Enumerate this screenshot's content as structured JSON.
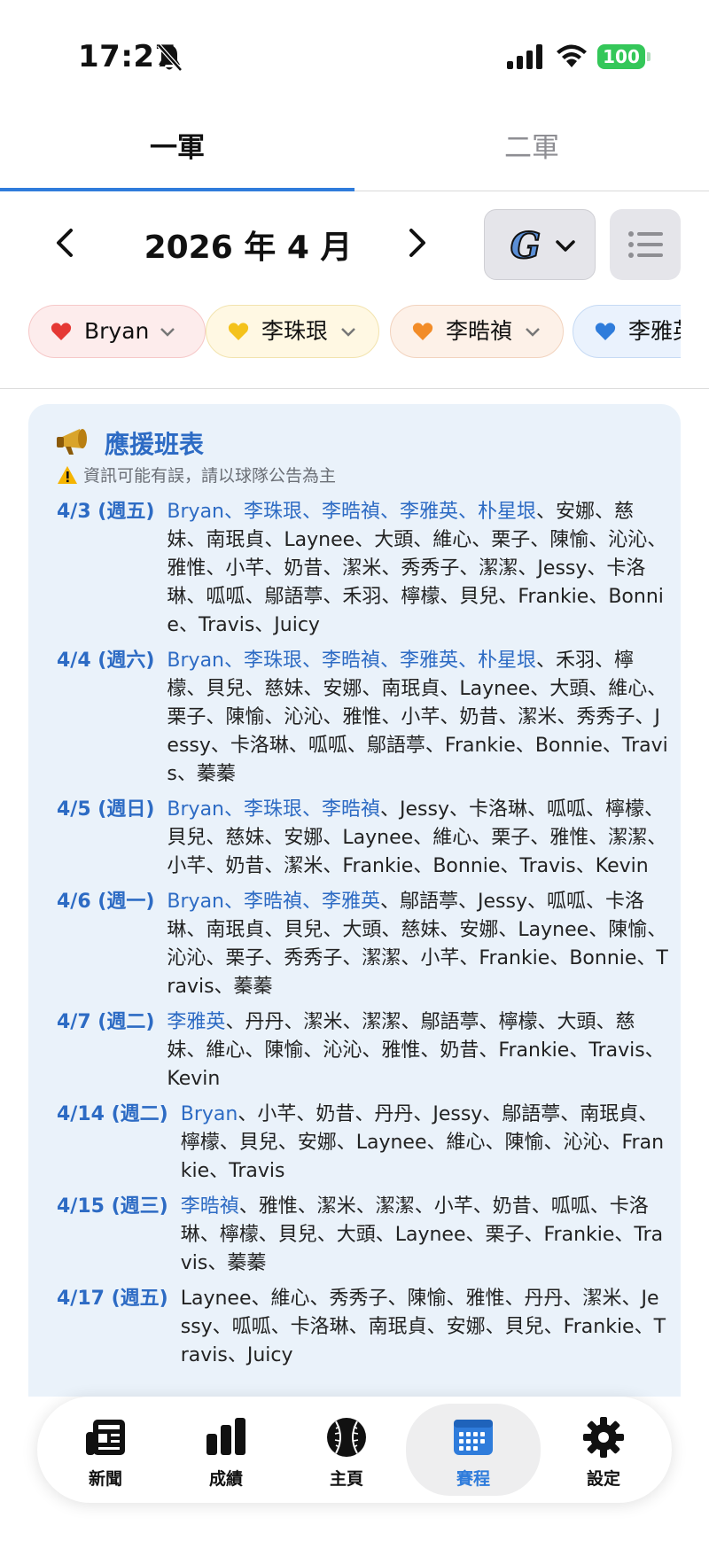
{
  "status": {
    "time": "17:27",
    "battery": "100"
  },
  "team_tabs": [
    {
      "label": "一軍",
      "active": true
    },
    {
      "label": "二軍",
      "active": false
    }
  ],
  "month_nav": {
    "label": "2026 年 4 月"
  },
  "team_selector": {
    "logo": "G"
  },
  "chips": [
    {
      "label": "Bryan",
      "color": "#e53935"
    },
    {
      "label": "李珠珢",
      "color": "#f4c21b"
    },
    {
      "label": "李晧禎",
      "color": "#f28c28"
    },
    {
      "label": "李雅英",
      "color": "#2f7cdb"
    }
  ],
  "roster": {
    "title": "應援班表",
    "note": "資訊可能有誤，請以球隊公告為主",
    "rows": [
      {
        "date": "4/3 (週五)",
        "highlight": "Bryan、李珠珢、李晧禎、李雅英、朴星垠",
        "names": "、安娜、慈妹、南珉貞、Laynee、大頭、維心、栗子、陳愉、沁沁、雅惟、小芊、奶昔、潔米、秀秀子、潔潔、Jessy、卡洛琳、呱呱、鄔語葶、禾羽、檸檬、貝兒、Frankie、Bonnie、Travis、Juicy"
      },
      {
        "date": "4/4 (週六)",
        "highlight": "Bryan、李珠珢、李晧禎、李雅英、朴星垠",
        "names": "、禾羽、檸檬、貝兒、慈妹、安娜、南珉貞、Laynee、大頭、維心、栗子、陳愉、沁沁、雅惟、小芊、奶昔、潔米、秀秀子、Jessy、卡洛琳、呱呱、鄔語葶、Frankie、Bonnie、Travis、蓁蓁"
      },
      {
        "date": "4/5 (週日)",
        "highlight": "Bryan、李珠珢、李晧禎",
        "names": "、Jessy、卡洛琳、呱呱、檸檬、貝兒、慈妹、安娜、Laynee、維心、栗子、雅惟、潔潔、小芊、奶昔、潔米、Frankie、Bonnie、Travis、Kevin"
      },
      {
        "date": "4/6 (週一)",
        "highlight": "Bryan、李晧禎、李雅英",
        "names": "、鄔語葶、Jessy、呱呱、卡洛琳、南珉貞、貝兒、大頭、慈妹、安娜、Laynee、陳愉、沁沁、栗子、秀秀子、潔潔、小芊、Frankie、Bonnie、Travis、蓁蓁"
      },
      {
        "date": "4/7 (週二)",
        "highlight": "李雅英",
        "names": "、丹丹、潔米、潔潔、鄔語葶、檸檬、大頭、慈妹、維心、陳愉、沁沁、雅惟、奶昔、Frankie、Travis、Kevin"
      },
      {
        "date": "4/14 (週二)",
        "highlight": "Bryan",
        "names": "、小芊、奶昔、丹丹、Jessy、鄔語葶、南珉貞、檸檬、貝兒、安娜、Laynee、維心、陳愉、沁沁、Frankie、Travis"
      },
      {
        "date": "4/15 (週三)",
        "highlight": "李晧禎",
        "names": "、雅惟、潔米、潔潔、小芊、奶昔、呱呱、卡洛琳、檸檬、貝兒、大頭、Laynee、栗子、Frankie、Travis、蓁蓁"
      },
      {
        "date": "4/17 (週五)",
        "highlight": "",
        "names": "Laynee、維心、秀秀子、陳愉、雅惟、丹丹、潔米、Jessy、呱呱、卡洛琳、南珉貞、安娜、貝兒、Frankie、Travis、Juicy"
      }
    ]
  },
  "tab_bar": [
    {
      "label": "新聞",
      "icon": "newspaper-icon"
    },
    {
      "label": "成績",
      "icon": "bar-chart-icon"
    },
    {
      "label": "主頁",
      "icon": "baseball-icon"
    },
    {
      "label": "賽程",
      "icon": "calendar-icon",
      "active": true
    },
    {
      "label": "設定",
      "icon": "gear-icon"
    }
  ]
}
